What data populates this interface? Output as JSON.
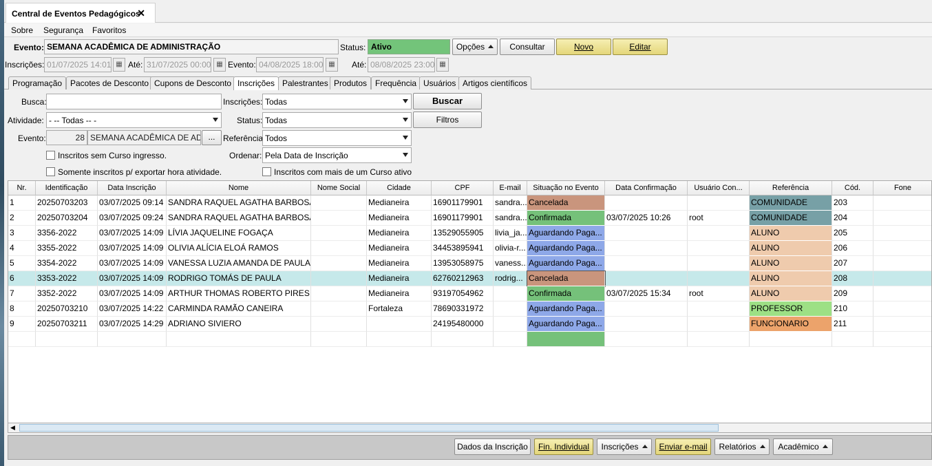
{
  "window": {
    "tab_title": "Central de Eventos Pedagógicos",
    "close_glyph": "✕"
  },
  "menu": [
    "Sobre",
    "Segurança",
    "Favoritos"
  ],
  "header": {
    "evento_label": "Evento:",
    "evento_value": "SEMANA ACADÊMICA DE ADMINISTRAÇÃO",
    "status_label": "Status:",
    "status_value": "Ativo",
    "opcoes": "Opções",
    "consultar": "Consultar",
    "novo": "Novo",
    "editar": "Editar",
    "inscricoes_label": "Inscrições:",
    "inscricoes_ini": "01/07/2025 14:01",
    "ate1_label": "Até:",
    "inscricoes_fim": "31/07/2025 00:00",
    "evento2_label": "Evento:",
    "evento_ini": "04/08/2025 18:00",
    "ate2_label": "Até:",
    "evento_fim": "08/08/2025 23:00"
  },
  "tabs": [
    "Programação",
    "Pacotes de Desconto",
    "Cupons de Desconto",
    "Inscrições",
    "Palestrantes",
    "Produtos",
    "Frequência",
    "Usuários",
    "Artigos científicos"
  ],
  "filters": {
    "busca_label": "Busca:",
    "busca_value": "",
    "inscricoes_label": "Inscrições:",
    "inscricoes_value": "Todas",
    "buscar_btn": "Buscar",
    "atividade_label": "Atividade:",
    "atividade_value": "- -- Todas -- -",
    "status_label": "Status:",
    "status_value": "Todas",
    "filtros_btn": "Filtros",
    "evento_label": "Evento:",
    "evento_code": "28",
    "evento_name": "SEMANA ACADÊMICA DE ADM",
    "evento_more": "...",
    "referencia_label": "Referência",
    "referencia_value": "Todos",
    "sem_curso_label": "Inscritos sem Curso ingresso.",
    "ordenar_label": "Ordenar:",
    "ordenar_value": "Pela Data de Inscrição",
    "somente_label": "Somente inscritos p/ exportar hora atividade.",
    "mais_curso_label": "Inscritos com mais de um Curso ativo"
  },
  "table": {
    "columns": [
      "Nr.",
      "Identificação",
      "Data Inscrição",
      "Nome",
      "Nome Social",
      "Cidade",
      "CPF",
      "E-mail",
      "Situação no Evento",
      "Data Confirmação",
      "Usuário Con...",
      "Referência",
      "Cód.",
      "Fone"
    ],
    "rows": [
      [
        "1",
        "20250703203",
        "03/07/2025 09:14",
        "SANDRA RAQUEL AGATHA BARBOSA",
        "",
        "Medianeira",
        "16901179901",
        "sandra...",
        "Cancelada",
        "",
        "",
        "COMUNIDADE",
        "203",
        ""
      ],
      [
        "2",
        "20250703204",
        "03/07/2025 09:24",
        "SANDRA RAQUEL AGATHA BARBOSA",
        "",
        "Medianeira",
        "16901179901",
        "sandra...",
        "Confirmada",
        "03/07/2025 10:26",
        "root",
        "COMUNIDADE",
        "204",
        ""
      ],
      [
        "3",
        "3356-2022",
        "03/07/2025 14:09",
        "LÍVIA JAQUELINE FOGAÇA",
        "",
        "Medianeira",
        "13529055905",
        "livia_ja...",
        "Aguardando Paga...",
        "",
        "",
        "ALUNO",
        "205",
        ""
      ],
      [
        "4",
        "3355-2022",
        "03/07/2025 14:09",
        "OLIVIA ALÍCIA ELOÁ RAMOS",
        "",
        "Medianeira",
        "34453895941",
        "olivia-r...",
        "Aguardando Paga...",
        "",
        "",
        "ALUNO",
        "206",
        ""
      ],
      [
        "5",
        "3354-2022",
        "03/07/2025 14:09",
        "VANESSA LUZIA AMANDA DE PAULA",
        "",
        "Medianeira",
        "13953058975",
        "vaness...",
        "Aguardando Paga...",
        "",
        "",
        "ALUNO",
        "207",
        ""
      ],
      [
        "6",
        "3353-2022",
        "03/07/2025 14:09",
        "RODRIGO TOMÁS DE PAULA",
        "",
        "Medianeira",
        "62760212963",
        "rodrig...",
        "Cancelada",
        "",
        "",
        "ALUNO",
        "208",
        ""
      ],
      [
        "7",
        "3352-2022",
        "03/07/2025 14:09",
        "ARTHUR THOMAS ROBERTO PIRES",
        "",
        "Medianeira",
        "93197054962",
        "",
        "Confirmada",
        "03/07/2025 15:34",
        "root",
        "ALUNO",
        "209",
        ""
      ],
      [
        "8",
        "20250703210",
        "03/07/2025 14:22",
        "CARMINDA RAMÃO CANEIRA",
        "",
        "Fortaleza",
        "78690331972",
        "",
        "Aguardando Paga...",
        "",
        "",
        "PROFESSOR",
        "210",
        ""
      ],
      [
        "9",
        "20250703211",
        "03/07/2025 14:29",
        "ADRIANO SIVIERO",
        "",
        "",
        "24195480000",
        "",
        "Aguardando Paga...",
        "",
        "",
        "FUNCIONARIO",
        "211",
        ""
      ]
    ],
    "selected_row": 6
  },
  "colors": {
    "cancelada": "#c9957d",
    "confirmada": "#75c17a",
    "aguardando": "#8ea8e8",
    "comunidade": "#77a0a6",
    "aluno": "#efcbad",
    "professor": "#9de085",
    "funcionario": "#eca36b",
    "selected_row": "#c6e9ea",
    "status_ativo": "#73c47a"
  },
  "footer_buttons": {
    "dados": "Dados da Inscrição",
    "fin": "Fin. Individual",
    "inscricoes": "Inscrições",
    "enviar": "Enviar e-mail",
    "relatorios": "Relatórios",
    "academico": "Acadêmico"
  }
}
